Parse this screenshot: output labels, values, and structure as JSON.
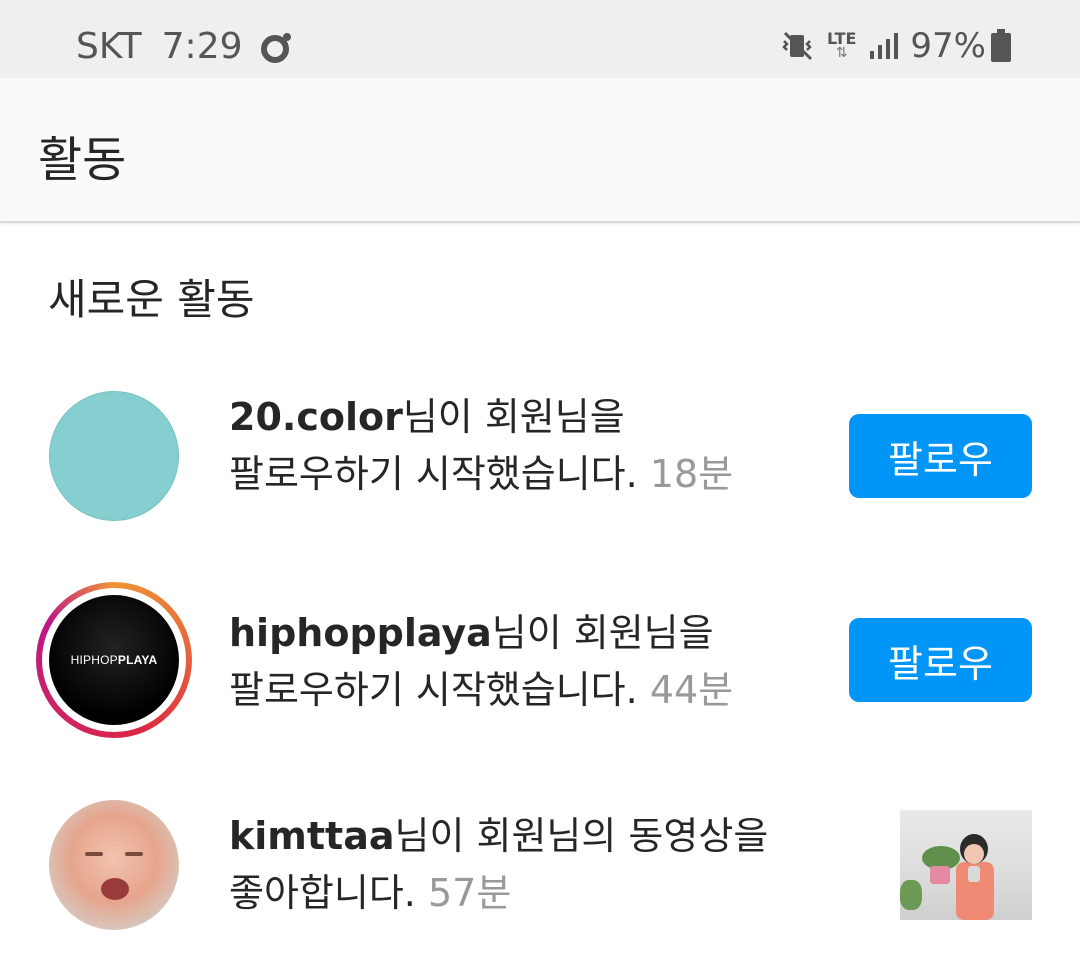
{
  "status_bar": {
    "carrier": "SKT",
    "time": "7:29",
    "network": "LTE",
    "battery": "97%",
    "icons": [
      "notification-dot-icon",
      "vibrate-icon",
      "lte-icon",
      "signal-icon",
      "battery-icon"
    ]
  },
  "header": {
    "title": "활동"
  },
  "section": {
    "title": "새로운 활동"
  },
  "notifications": [
    {
      "user": "20.color",
      "line1_suffix": "님이 회원님을",
      "line2": "팔로우하기 시작했습니다. ",
      "time": "18분",
      "action": "팔로우"
    },
    {
      "user": "hiphopplaya",
      "avatar_logo_thin": "HIPHOP",
      "avatar_logo_bold": "PLAYA",
      "line1_suffix": "님이 회원님을",
      "line2": "팔로우하기 시작했습니다. ",
      "time": "44분",
      "action": "팔로우"
    },
    {
      "user": "kimttaa",
      "line1_suffix": "님이 회원님의 동영상을",
      "line2": "좋아합니다. ",
      "time": "57분"
    }
  ],
  "colors": {
    "follow_button": "#0095f6",
    "avatar_teal": "#86cfd0",
    "timestamp": "#999999"
  }
}
